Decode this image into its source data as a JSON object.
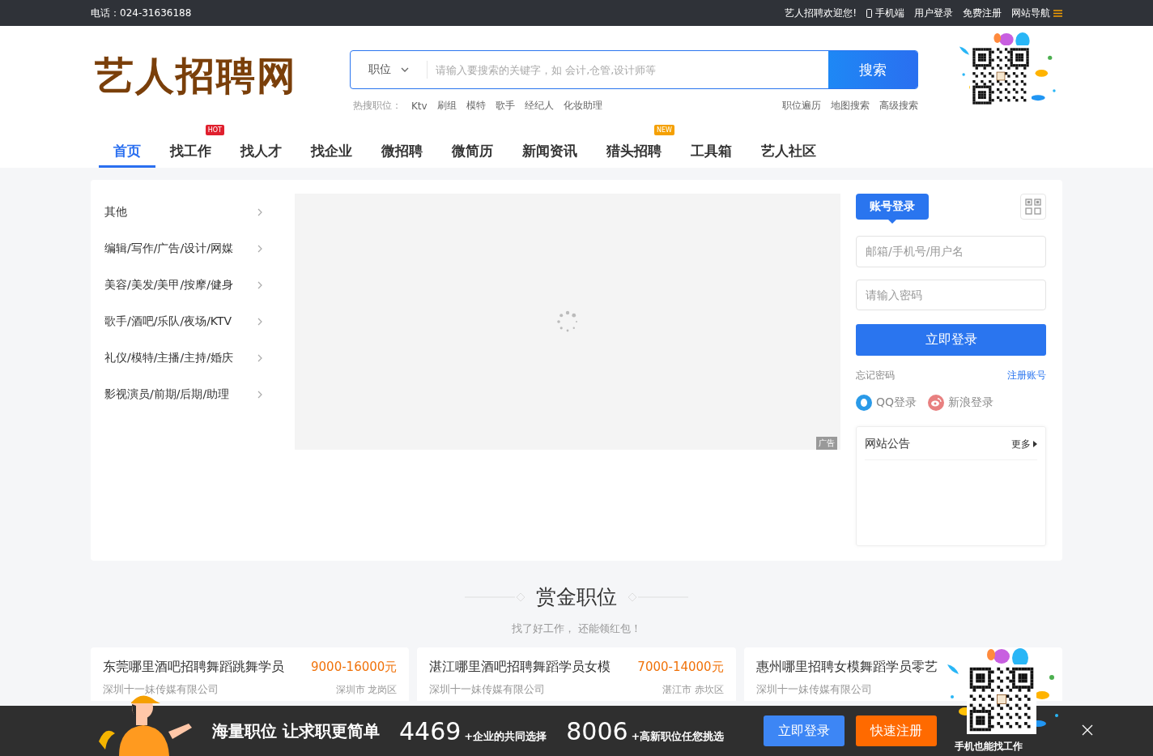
{
  "top_bar": {
    "phone": "电话：024-31636188",
    "welcome": "艺人招聘欢迎您!",
    "links": [
      {
        "label": "手机端",
        "kind": "mobile"
      },
      {
        "label": "用户登录",
        "kind": "plain"
      },
      {
        "label": "免费注册",
        "kind": "plain"
      },
      {
        "label": "网站导航",
        "kind": "menu"
      }
    ]
  },
  "logo": "艺人招聘网",
  "search": {
    "type": "职位",
    "placeholder": "请输入要搜索的关键字，如 会计,仓管,设计师等",
    "button": "搜索",
    "hot_label": "热搜职位：",
    "hot": [
      "Ktv",
      "刷组",
      "模特",
      "歌手",
      "经纪人",
      "化妆助理"
    ],
    "links": [
      "职位遍历",
      "地图搜索",
      "高级搜索"
    ]
  },
  "nav": [
    {
      "label": "首页",
      "selected": true
    },
    {
      "label": "找工作",
      "selected": false,
      "badge": {
        "text": "HOT",
        "color": "#e0202e"
      }
    },
    {
      "label": "找人才",
      "selected": false
    },
    {
      "label": "找企业",
      "selected": false
    },
    {
      "label": "微招聘",
      "selected": false
    },
    {
      "label": "微简历",
      "selected": false
    },
    {
      "label": "新闻资讯",
      "selected": false
    },
    {
      "label": "猎头招聘",
      "selected": false,
      "badge": {
        "text": "NEW",
        "color": "#f5a000"
      }
    },
    {
      "label": "工具箱",
      "selected": false
    },
    {
      "label": "艺人社区",
      "selected": false
    }
  ],
  "categories": [
    "其他",
    "编辑/写作/广告/设计/网媒",
    "美容/美发/美甲/按摩/健身",
    "歌手/酒吧/乐队/夜场/KTV",
    "礼仪/模特/主播/主持/婚庆",
    "影视演员/前期/后期/助理"
  ],
  "banner": {
    "tag": "广告"
  },
  "login": {
    "tab": "账号登录",
    "username_placeholder": "邮箱/手机号/用户名",
    "password_placeholder": "请输入密码",
    "submit": "立即登录",
    "forgot": "忘记密码",
    "register": "注册账号",
    "social": [
      {
        "label": "QQ登录",
        "kind": "qq"
      },
      {
        "label": "新浪登录",
        "kind": "weibo"
      }
    ]
  },
  "notice": {
    "title": "网站公告",
    "more": "更多"
  },
  "bounty": {
    "title": "赏金职位",
    "subtitle": "找了好工作， 还能领红包！"
  },
  "jobs": [
    {
      "title": "东莞哪里酒吧招聘舞蹈跳舞学员",
      "salary": "9000-16000元",
      "company": "深圳十一妹传媒有限公司",
      "location": "深圳市 龙岗区"
    },
    {
      "title": "湛江哪里酒吧招聘舞蹈学员女模",
      "salary": "7000-14000元",
      "company": "深圳十一妹传媒有限公司",
      "location": "湛江市 赤坎区"
    },
    {
      "title": "惠州哪里招聘女模舞蹈学员零艺",
      "company": "深圳十一妹传媒有限公司"
    }
  ],
  "promo_bar": {
    "slogan": "海量职位 让求职更简单",
    "stats": [
      {
        "number": "4469",
        "label": "+企业的共同选择"
      },
      {
        "number": "8006",
        "label": "+高新职位任您挑选"
      }
    ],
    "login": "立即登录",
    "register": "快速注册",
    "qr_caption": "手机也能找工作"
  }
}
